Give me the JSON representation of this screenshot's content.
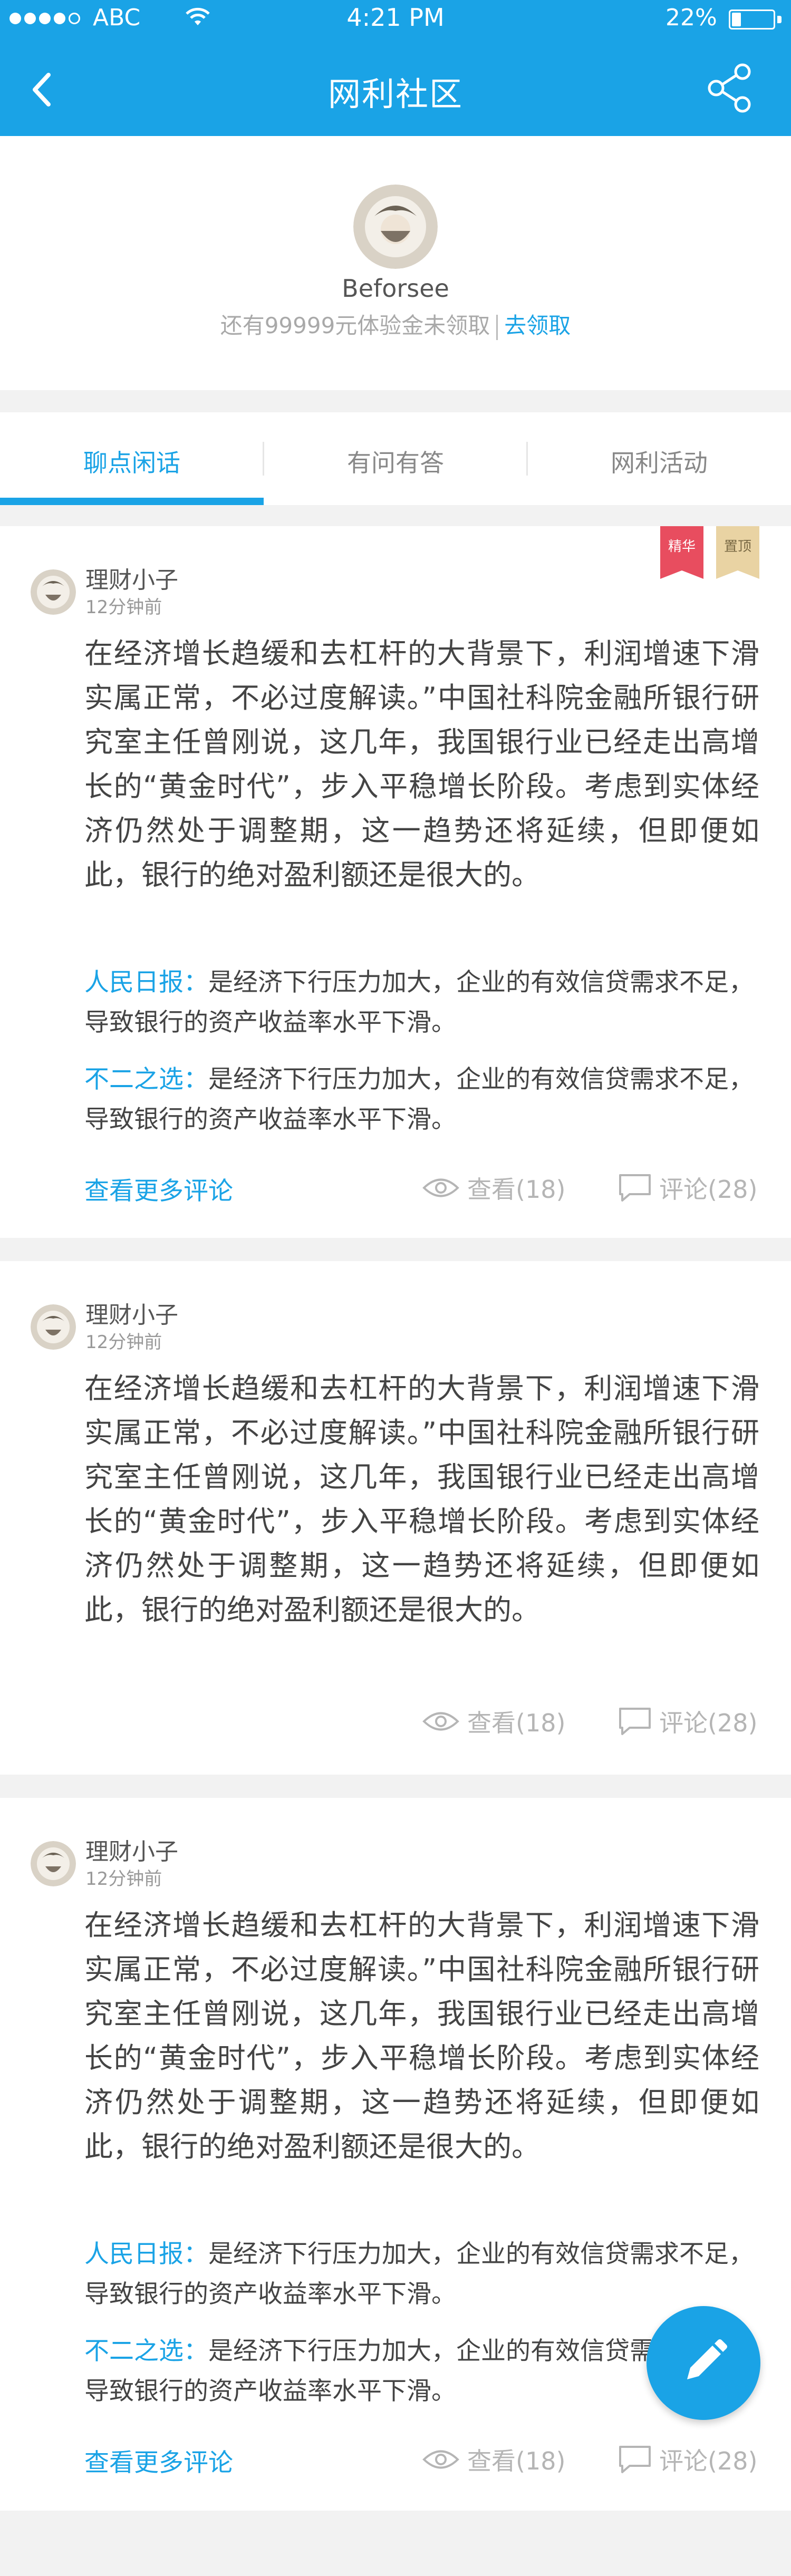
{
  "status_bar": {
    "carrier": "ABC",
    "time": "4:21 PM",
    "battery_percent_label": "22%",
    "battery_level": 0.22
  },
  "nav": {
    "title": "网利社区",
    "back_icon": "chevron-left-icon",
    "share_icon": "share-icon"
  },
  "profile": {
    "username": "Beforsee",
    "promo_text": "还有99999元体验金未领取",
    "promo_link": "去领取"
  },
  "tabs": [
    {
      "label": "聊点闲话",
      "active": true
    },
    {
      "label": "有问有答",
      "active": false
    },
    {
      "label": "网利活动",
      "active": false
    }
  ],
  "posts": [
    {
      "author": "理财小子",
      "time": "12分钟前",
      "badges": [
        "精华",
        "置顶"
      ],
      "body": "在经济增长趋缓和去杠杆的大背景下，利润增速下滑实属正常，不必过度解读。”中国社科院金融所银行研究室主任曾刚说，这几年，我国银行业已经走出高增长的“黄金时代”，步入平稳增长阶段。考虑到实体经济仍然处于调整期，这一趋势还将延续，但即便如此，银行的绝对盈利额还是很大的。",
      "comments": [
        {
          "who": "人民日报：",
          "text": "是经济下行压力加大，企业的有效信贷需求不足，导致银行的资产收益率水平下滑。"
        },
        {
          "who": "不二之选：",
          "text": "是经济下行压力加大，企业的有效信贷需求不足，导致银行的资产收益率水平下滑。"
        }
      ],
      "more_label": "查看更多评论",
      "views_label": "查看(18)",
      "comments_label": "评论(28)"
    },
    {
      "author": "理财小子",
      "time": "12分钟前",
      "body": "在经济增长趋缓和去杠杆的大背景下，利润增速下滑实属正常，不必过度解读。”中国社科院金融所银行研究室主任曾刚说，这几年，我国银行业已经走出高增长的“黄金时代”，步入平稳增长阶段。考虑到实体经济仍然处于调整期，这一趋势还将延续，但即便如此，银行的绝对盈利额还是很大的。",
      "views_label": "查看(18)",
      "comments_label": "评论(28)"
    },
    {
      "author": "理财小子",
      "time": "12分钟前",
      "body": "在经济增长趋缓和去杠杆的大背景下，利润增速下滑实属正常，不必过度解读。”中国社科院金融所银行研究室主任曾刚说，这几年，我国银行业已经走出高增长的“黄金时代”，步入平稳增长阶段。考虑到实体经济仍然处于调整期，这一趋势还将延续，但即便如此，银行的绝对盈利额还是很大的。",
      "comments": [
        {
          "who": "人民日报：",
          "text": "是经济下行压力加大，企业的有效信贷需求不足，导致银行的资产收益率水平下滑。"
        },
        {
          "who": "不二之选：",
          "text": "是经济下行压力加大，企业的有效信贷需求不足，导致银行的资产收益率水平下滑。"
        }
      ],
      "more_label": "查看更多评论",
      "views_label": "查看(18)",
      "comments_label": "评论(28)"
    }
  ],
  "fab": {
    "icon": "pencil-icon"
  },
  "colors": {
    "accent": "#1aa3e6",
    "badge_jinghua": "#e84d5f",
    "badge_zhiding": "#e9d3a3"
  }
}
